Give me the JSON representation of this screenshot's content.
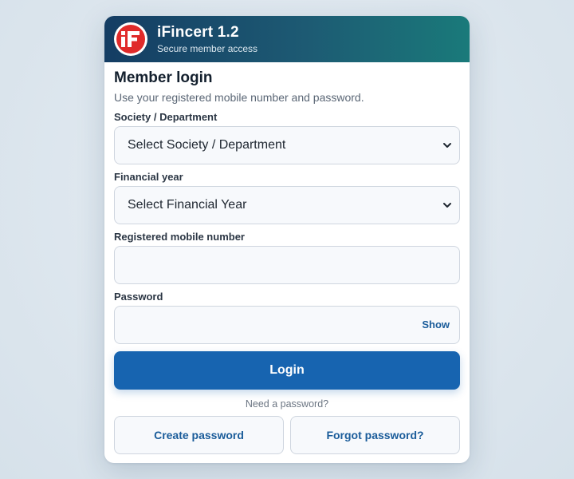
{
  "app": {
    "title": "iFincert 1.2",
    "subtitle": "Secure member access"
  },
  "form": {
    "heading": "Member login",
    "description": "Use your registered mobile number and password.",
    "society": {
      "label": "Society / Department",
      "selected": "Select Society / Department"
    },
    "financial_year": {
      "label": "Financial year",
      "selected": "Select Financial Year"
    },
    "mobile": {
      "label": "Registered mobile number",
      "value": ""
    },
    "password": {
      "label": "Password",
      "value": "",
      "toggle_label": "Show"
    },
    "login_label": "Login",
    "need_password_text": "Need a password?",
    "create_password_label": "Create password",
    "forgot_password_label": "Forgot password?"
  },
  "colors": {
    "primary": "#1764b0",
    "header_start": "#143d63",
    "header_end": "#1a7a7a",
    "logo_red": "#e02a2a",
    "link": "#1a5c9a"
  },
  "icons": {
    "logo": "ifincert-logo-icon",
    "select_arrow": "chevron-down-icon"
  }
}
